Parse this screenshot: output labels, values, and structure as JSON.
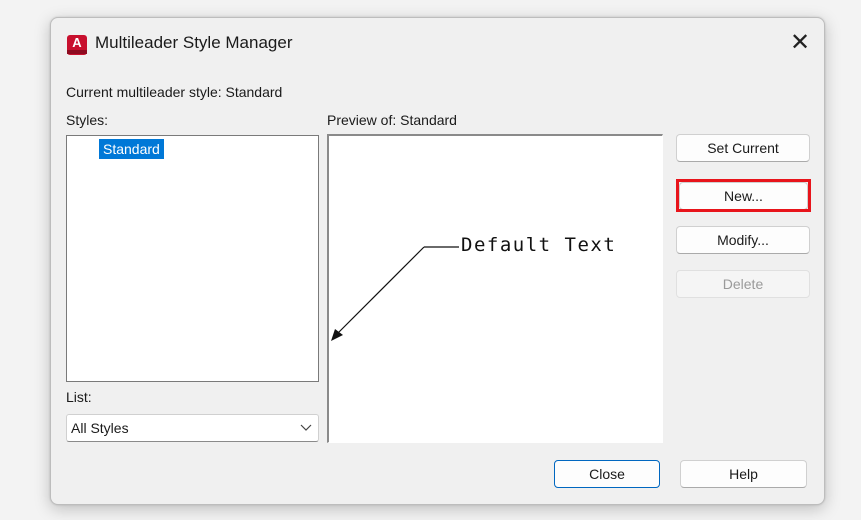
{
  "window": {
    "title": "Multileader Style Manager",
    "app_icon_letter": "A"
  },
  "current_style": {
    "label": "Current multileader style: Standard"
  },
  "styles": {
    "label": "Styles:",
    "items": [
      "Standard"
    ],
    "selected": "Standard"
  },
  "preview": {
    "label": "Preview of: Standard",
    "leader_text": "Default Text"
  },
  "list_filter": {
    "label": "List:",
    "selected": "All Styles"
  },
  "buttons": {
    "set_current": "Set Current",
    "new": "New...",
    "modify": "Modify...",
    "delete": "Delete",
    "close": "Close",
    "help": "Help"
  },
  "annotation": {
    "highlight_target": "new",
    "highlight_color": "#e8141b"
  },
  "colors": {
    "selection": "#0078d7",
    "app_icon": "#c8102e"
  }
}
